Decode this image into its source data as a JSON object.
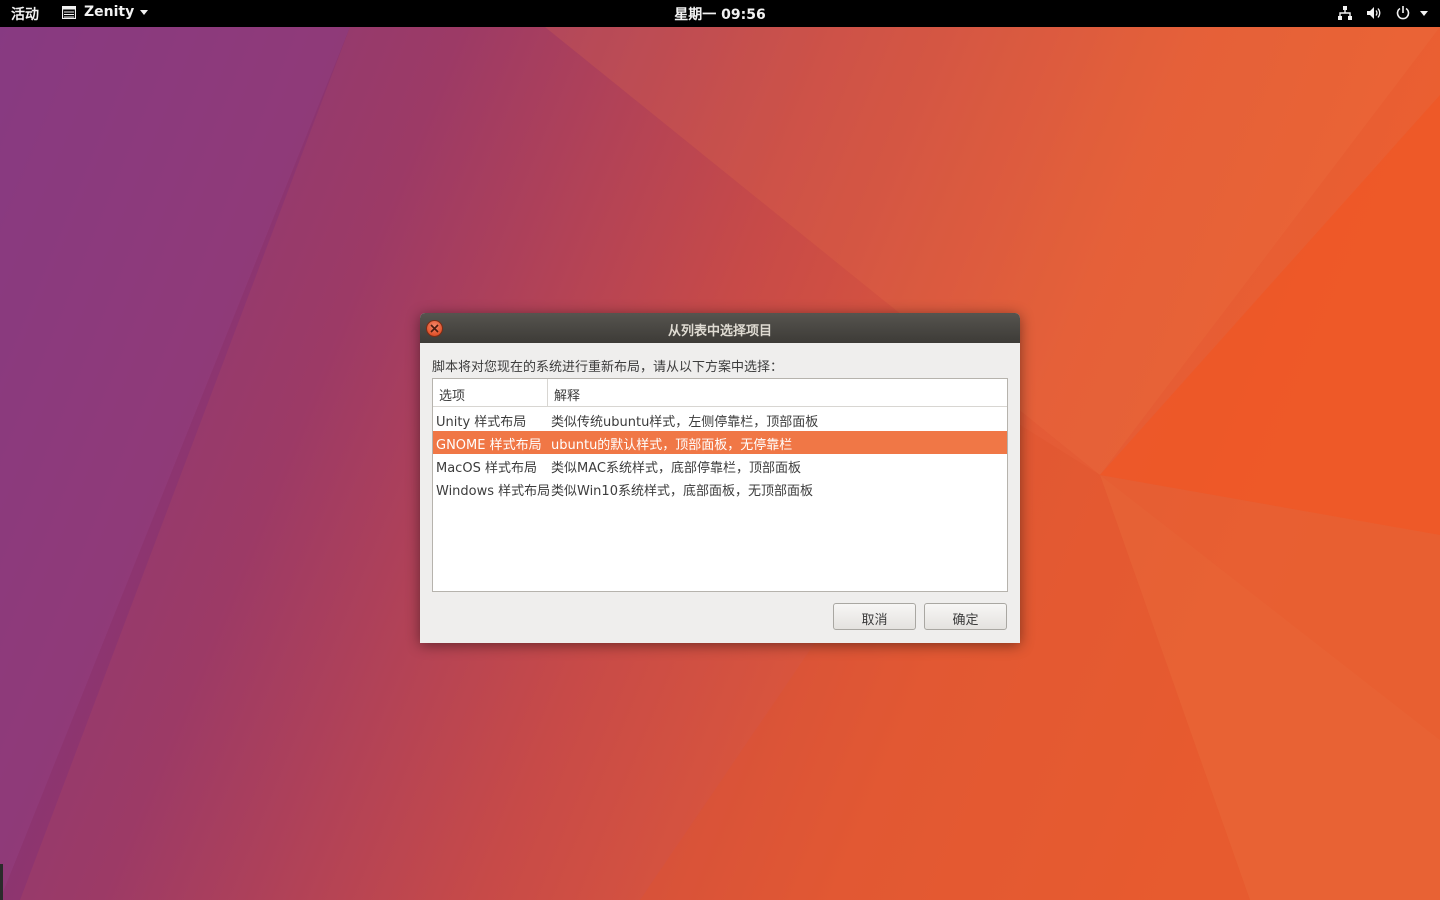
{
  "topbar": {
    "activities_label": "活动",
    "app_name": "Zenity",
    "clock": "星期一 09:56",
    "tray_icons": [
      "network-icon",
      "volume-icon",
      "power-icon",
      "chevron-down-icon"
    ],
    "text_color": "#f2f2f2"
  },
  "desktop": {
    "wallpaper_colors": [
      "#8a3a7e",
      "#a8415a",
      "#e0553a",
      "#ea5b2a"
    ]
  },
  "dialog": {
    "title": "从列表中选择项目",
    "prompt": "脚本将对您现在的系统进行重新布局，请从以下方案中选择：",
    "columns": [
      "选项",
      "解释"
    ],
    "rows": [
      {
        "option": "Unity 样式布局",
        "description": "类似传统ubuntu样式，左侧停靠栏，顶部面板",
        "selected": false
      },
      {
        "option": "GNOME 样式布局",
        "description": "ubuntu的默认样式，顶部面板，无停靠栏",
        "selected": true
      },
      {
        "option": "MacOS 样式布局",
        "description": "类似MAC系统样式，底部停靠栏，顶部面板",
        "selected": false
      },
      {
        "option": "Windows 样式布局",
        "description": "类似Win10系统样式，底部面板，无顶部面板",
        "selected": false
      }
    ],
    "cancel_label": "取消",
    "ok_label": "确定",
    "selection_color": "#f07746"
  }
}
